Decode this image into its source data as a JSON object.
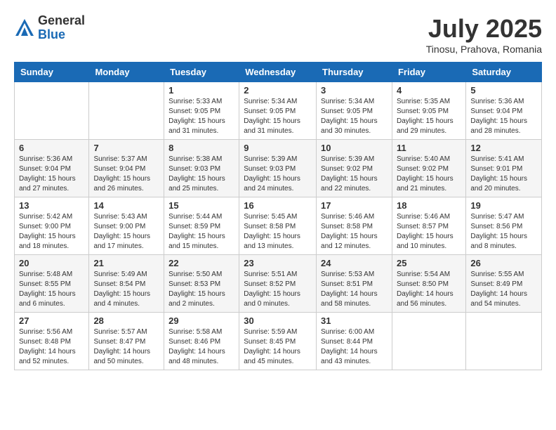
{
  "header": {
    "logo_general": "General",
    "logo_blue": "Blue",
    "month_title": "July 2025",
    "location": "Tinosu, Prahova, Romania"
  },
  "days_of_week": [
    "Sunday",
    "Monday",
    "Tuesday",
    "Wednesday",
    "Thursday",
    "Friday",
    "Saturday"
  ],
  "weeks": [
    [
      {
        "day": "",
        "sunrise": "",
        "sunset": "",
        "daylight": ""
      },
      {
        "day": "",
        "sunrise": "",
        "sunset": "",
        "daylight": ""
      },
      {
        "day": "1",
        "sunrise": "Sunrise: 5:33 AM",
        "sunset": "Sunset: 9:05 PM",
        "daylight": "Daylight: 15 hours and 31 minutes."
      },
      {
        "day": "2",
        "sunrise": "Sunrise: 5:34 AM",
        "sunset": "Sunset: 9:05 PM",
        "daylight": "Daylight: 15 hours and 31 minutes."
      },
      {
        "day": "3",
        "sunrise": "Sunrise: 5:34 AM",
        "sunset": "Sunset: 9:05 PM",
        "daylight": "Daylight: 15 hours and 30 minutes."
      },
      {
        "day": "4",
        "sunrise": "Sunrise: 5:35 AM",
        "sunset": "Sunset: 9:05 PM",
        "daylight": "Daylight: 15 hours and 29 minutes."
      },
      {
        "day": "5",
        "sunrise": "Sunrise: 5:36 AM",
        "sunset": "Sunset: 9:04 PM",
        "daylight": "Daylight: 15 hours and 28 minutes."
      }
    ],
    [
      {
        "day": "6",
        "sunrise": "Sunrise: 5:36 AM",
        "sunset": "Sunset: 9:04 PM",
        "daylight": "Daylight: 15 hours and 27 minutes."
      },
      {
        "day": "7",
        "sunrise": "Sunrise: 5:37 AM",
        "sunset": "Sunset: 9:04 PM",
        "daylight": "Daylight: 15 hours and 26 minutes."
      },
      {
        "day": "8",
        "sunrise": "Sunrise: 5:38 AM",
        "sunset": "Sunset: 9:03 PM",
        "daylight": "Daylight: 15 hours and 25 minutes."
      },
      {
        "day": "9",
        "sunrise": "Sunrise: 5:39 AM",
        "sunset": "Sunset: 9:03 PM",
        "daylight": "Daylight: 15 hours and 24 minutes."
      },
      {
        "day": "10",
        "sunrise": "Sunrise: 5:39 AM",
        "sunset": "Sunset: 9:02 PM",
        "daylight": "Daylight: 15 hours and 22 minutes."
      },
      {
        "day": "11",
        "sunrise": "Sunrise: 5:40 AM",
        "sunset": "Sunset: 9:02 PM",
        "daylight": "Daylight: 15 hours and 21 minutes."
      },
      {
        "day": "12",
        "sunrise": "Sunrise: 5:41 AM",
        "sunset": "Sunset: 9:01 PM",
        "daylight": "Daylight: 15 hours and 20 minutes."
      }
    ],
    [
      {
        "day": "13",
        "sunrise": "Sunrise: 5:42 AM",
        "sunset": "Sunset: 9:00 PM",
        "daylight": "Daylight: 15 hours and 18 minutes."
      },
      {
        "day": "14",
        "sunrise": "Sunrise: 5:43 AM",
        "sunset": "Sunset: 9:00 PM",
        "daylight": "Daylight: 15 hours and 17 minutes."
      },
      {
        "day": "15",
        "sunrise": "Sunrise: 5:44 AM",
        "sunset": "Sunset: 8:59 PM",
        "daylight": "Daylight: 15 hours and 15 minutes."
      },
      {
        "day": "16",
        "sunrise": "Sunrise: 5:45 AM",
        "sunset": "Sunset: 8:58 PM",
        "daylight": "Daylight: 15 hours and 13 minutes."
      },
      {
        "day": "17",
        "sunrise": "Sunrise: 5:46 AM",
        "sunset": "Sunset: 8:58 PM",
        "daylight": "Daylight: 15 hours and 12 minutes."
      },
      {
        "day": "18",
        "sunrise": "Sunrise: 5:46 AM",
        "sunset": "Sunset: 8:57 PM",
        "daylight": "Daylight: 15 hours and 10 minutes."
      },
      {
        "day": "19",
        "sunrise": "Sunrise: 5:47 AM",
        "sunset": "Sunset: 8:56 PM",
        "daylight": "Daylight: 15 hours and 8 minutes."
      }
    ],
    [
      {
        "day": "20",
        "sunrise": "Sunrise: 5:48 AM",
        "sunset": "Sunset: 8:55 PM",
        "daylight": "Daylight: 15 hours and 6 minutes."
      },
      {
        "day": "21",
        "sunrise": "Sunrise: 5:49 AM",
        "sunset": "Sunset: 8:54 PM",
        "daylight": "Daylight: 15 hours and 4 minutes."
      },
      {
        "day": "22",
        "sunrise": "Sunrise: 5:50 AM",
        "sunset": "Sunset: 8:53 PM",
        "daylight": "Daylight: 15 hours and 2 minutes."
      },
      {
        "day": "23",
        "sunrise": "Sunrise: 5:51 AM",
        "sunset": "Sunset: 8:52 PM",
        "daylight": "Daylight: 15 hours and 0 minutes."
      },
      {
        "day": "24",
        "sunrise": "Sunrise: 5:53 AM",
        "sunset": "Sunset: 8:51 PM",
        "daylight": "Daylight: 14 hours and 58 minutes."
      },
      {
        "day": "25",
        "sunrise": "Sunrise: 5:54 AM",
        "sunset": "Sunset: 8:50 PM",
        "daylight": "Daylight: 14 hours and 56 minutes."
      },
      {
        "day": "26",
        "sunrise": "Sunrise: 5:55 AM",
        "sunset": "Sunset: 8:49 PM",
        "daylight": "Daylight: 14 hours and 54 minutes."
      }
    ],
    [
      {
        "day": "27",
        "sunrise": "Sunrise: 5:56 AM",
        "sunset": "Sunset: 8:48 PM",
        "daylight": "Daylight: 14 hours and 52 minutes."
      },
      {
        "day": "28",
        "sunrise": "Sunrise: 5:57 AM",
        "sunset": "Sunset: 8:47 PM",
        "daylight": "Daylight: 14 hours and 50 minutes."
      },
      {
        "day": "29",
        "sunrise": "Sunrise: 5:58 AM",
        "sunset": "Sunset: 8:46 PM",
        "daylight": "Daylight: 14 hours and 48 minutes."
      },
      {
        "day": "30",
        "sunrise": "Sunrise: 5:59 AM",
        "sunset": "Sunset: 8:45 PM",
        "daylight": "Daylight: 14 hours and 45 minutes."
      },
      {
        "day": "31",
        "sunrise": "Sunrise: 6:00 AM",
        "sunset": "Sunset: 8:44 PM",
        "daylight": "Daylight: 14 hours and 43 minutes."
      },
      {
        "day": "",
        "sunrise": "",
        "sunset": "",
        "daylight": ""
      },
      {
        "day": "",
        "sunrise": "",
        "sunset": "",
        "daylight": ""
      }
    ]
  ]
}
